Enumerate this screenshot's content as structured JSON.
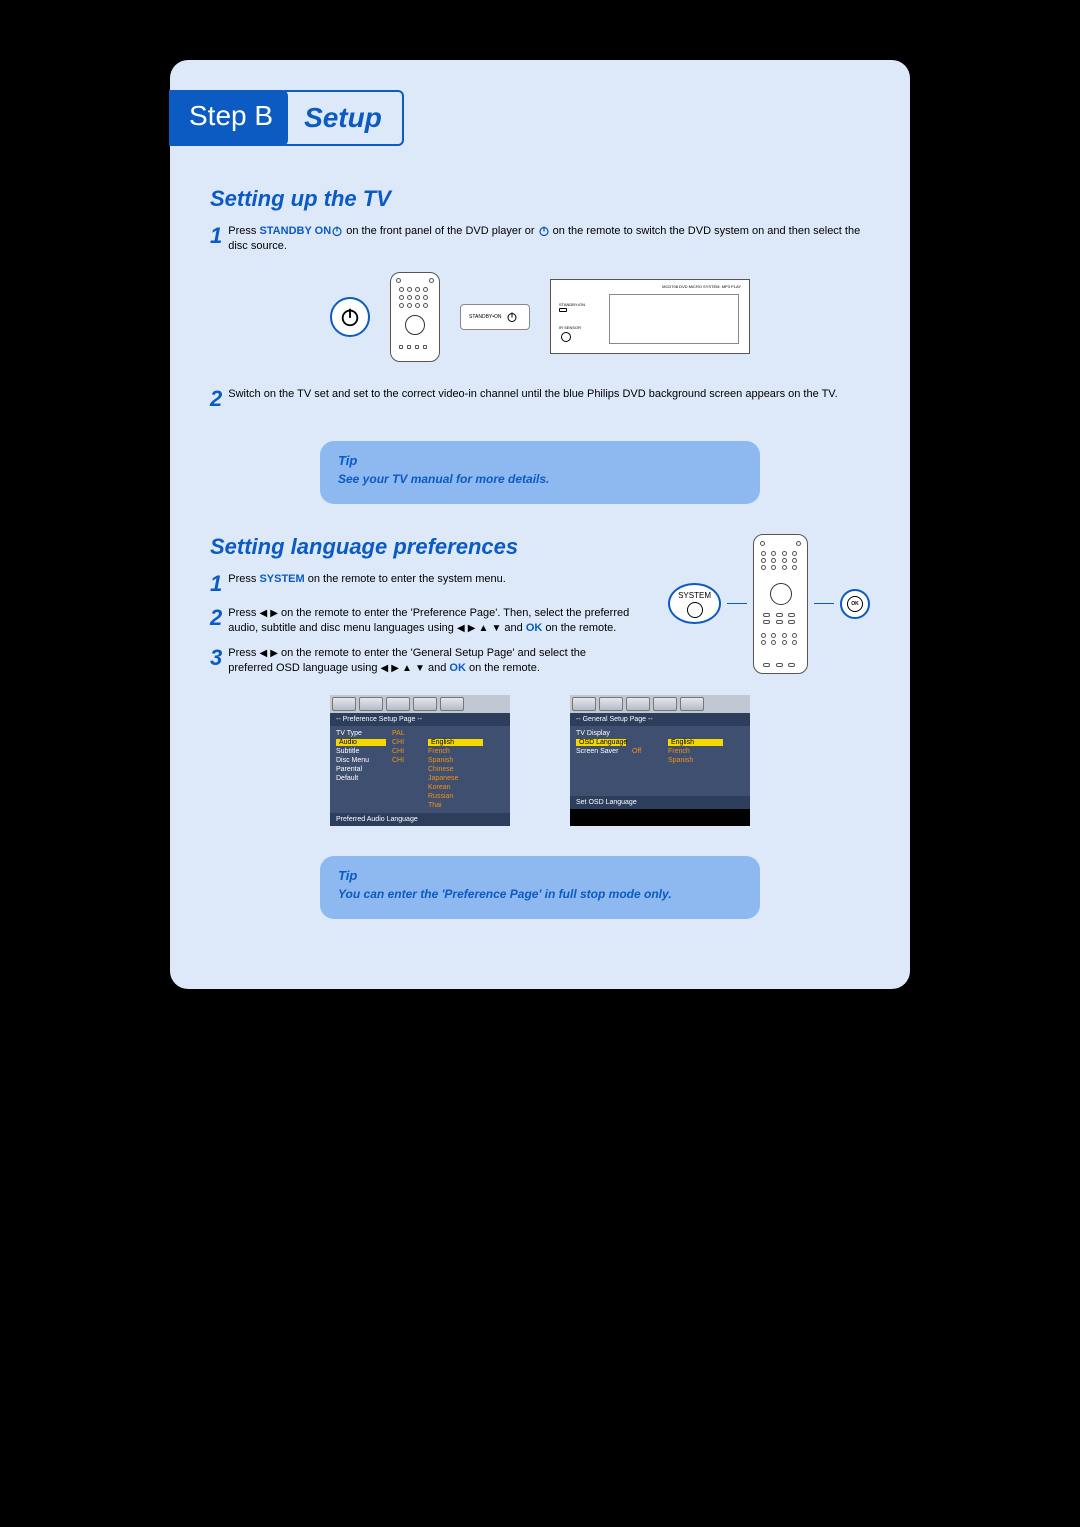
{
  "header": {
    "step_label": "Step B",
    "setup_label": "Setup"
  },
  "section1": {
    "title": "Setting up the TV",
    "step1_num": "1",
    "step1_a": "Press ",
    "step1_b": "STANDBY ON",
    "step1_c": " on the front panel of the DVD player or ",
    "step1_d": " on the remote to switch the DVD system on and then select the disc source.",
    "fig_label": "STANDBY•ON",
    "device_label": "MCD708 DVD MICRO SYSTEM. MP3 PLAY",
    "device_sub1": "STANDBY•ON",
    "device_sub2": "IR SENSOR",
    "step2_num": "2",
    "step2_text": "Switch on the TV set and set to the correct video-in channel until the blue Philips DVD background screen appears on the TV."
  },
  "tip1": {
    "title": "Tip",
    "text": "See your TV manual for more details."
  },
  "section2": {
    "title": "Setting language preferences",
    "step1_num": "1",
    "step1_a": "Press ",
    "step1_b": "SYSTEM",
    "step1_c": " on the remote to enter the system menu.",
    "step2_num": "2",
    "step2_a": "Press ",
    "step2_b": " on the remote to enter the 'Preference Page'. Then, select the preferred audio, subtitle and disc menu languages using ",
    "step2_c": " and ",
    "step2_d": "OK",
    "step2_e": "  on the remote.",
    "step3_num": "3",
    "step3_a": "Press ",
    "step3_b": " on the remote to enter the 'General Setup Page' and select the preferred OSD language using ",
    "step3_c": " and ",
    "step3_d": "OK",
    "step3_e": "  on the remote.",
    "system_label": "SYSTEM",
    "ok_label": "OK"
  },
  "osd1": {
    "header": "-- Preference Setup Page --",
    "rows": [
      [
        "TV Type",
        "PAL",
        ""
      ],
      [
        "Audio",
        "CHI",
        "English"
      ],
      [
        "Subtitle",
        "CHI",
        "French"
      ],
      [
        "Disc Menu",
        "CHI",
        "Spanish"
      ],
      [
        "Parental",
        "",
        "Chinese"
      ],
      [
        "Default",
        "",
        "Japanese"
      ],
      [
        "",
        "",
        "Korean"
      ],
      [
        "",
        "",
        "Russian"
      ],
      [
        "",
        "",
        "Thai"
      ]
    ],
    "highlight_row": 1,
    "footer": "Preferred Audio Language"
  },
  "osd2": {
    "header": "-- General Setup Page --",
    "rows": [
      [
        "TV Display",
        "",
        ""
      ],
      [
        "OSD Language",
        "",
        "English"
      ],
      [
        "Screen Saver",
        "Off",
        "French"
      ],
      [
        "",
        "",
        "Spanish"
      ]
    ],
    "highlight_row": 1,
    "footer": "Set OSD Language"
  },
  "tip2": {
    "title": "Tip",
    "text": "You can enter the 'Preference Page' in full stop mode only."
  }
}
